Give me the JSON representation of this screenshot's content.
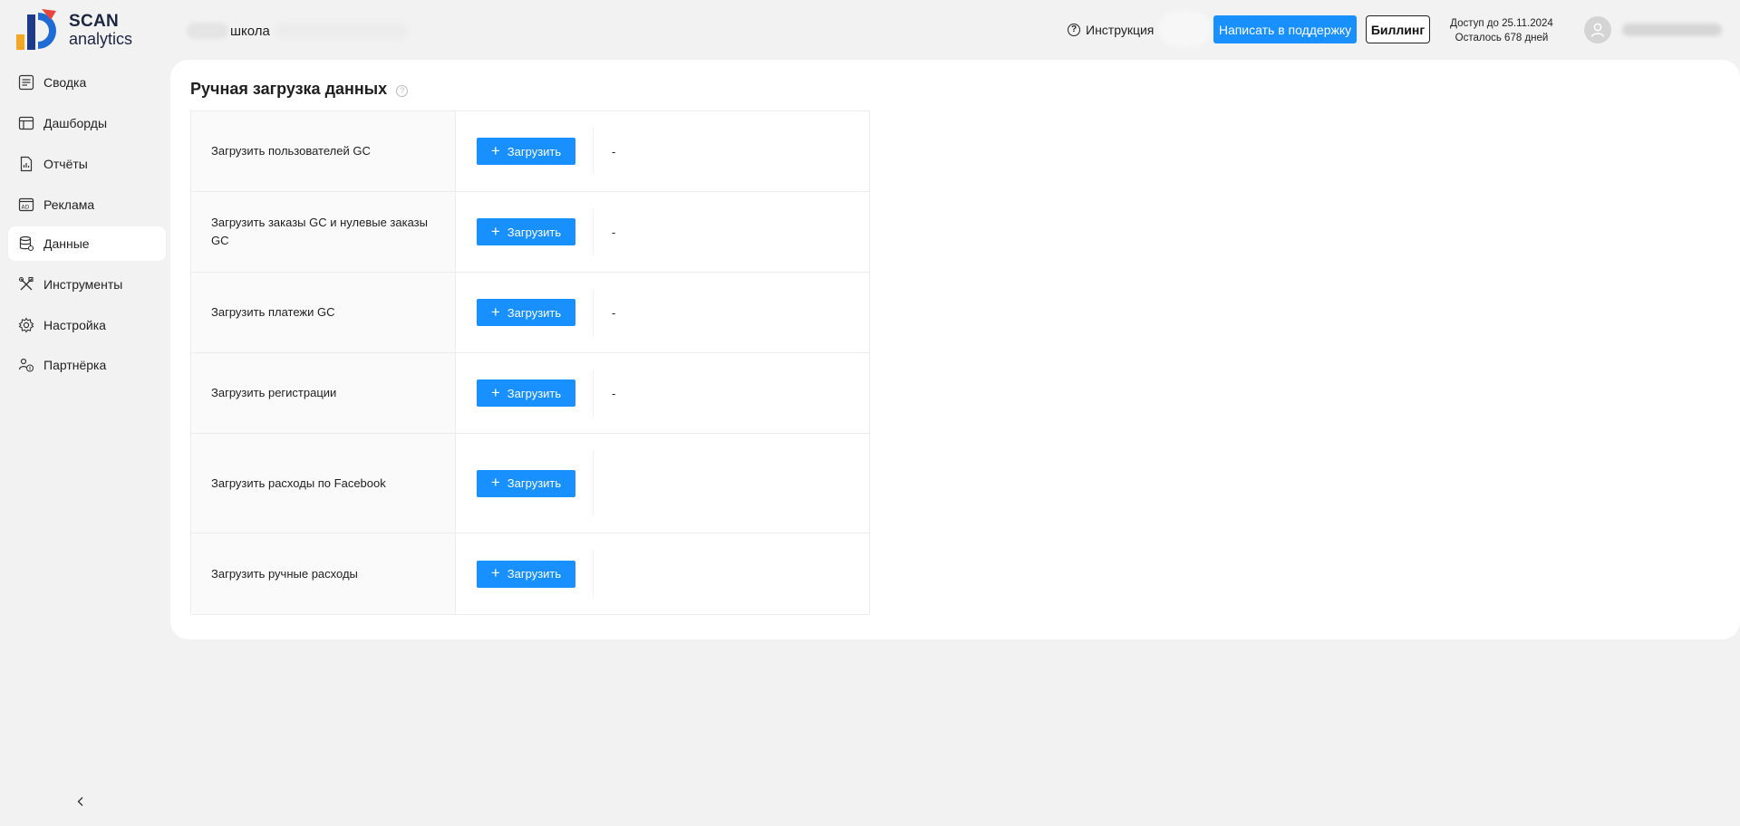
{
  "brand": {
    "line1": "SCAN",
    "line2": "analytics"
  },
  "header": {
    "project_name": "школа",
    "help_label": "Инструкция",
    "support_label": "Написать в поддержку",
    "billing_label": "Биллинг",
    "access_until": "Доступ до 25.11.2024",
    "days_left": "Осталось 678 дней"
  },
  "sidebar": {
    "items": [
      {
        "label": "Сводка",
        "icon": "summary-icon"
      },
      {
        "label": "Дашборды",
        "icon": "dashboard-icon"
      },
      {
        "label": "Отчёты",
        "icon": "report-icon"
      },
      {
        "label": "Реклама",
        "icon": "ads-icon"
      },
      {
        "label": "Данные",
        "icon": "database-icon",
        "active": true
      },
      {
        "label": "Инструменты",
        "icon": "tools-icon"
      },
      {
        "label": "Настройка",
        "icon": "settings-icon"
      },
      {
        "label": "Партнёрка",
        "icon": "partner-icon"
      }
    ]
  },
  "page": {
    "title": "Ручная загрузка данных",
    "upload_label": "Загрузить",
    "rows": [
      {
        "label": "Загрузить пользователей GC",
        "status": "-"
      },
      {
        "label": "Загрузить заказы GC и нулевые заказы GC",
        "status": "-"
      },
      {
        "label": "Загрузить платежи GC",
        "status": "-"
      },
      {
        "label": "Загрузить регистрации",
        "status": "-"
      },
      {
        "label": "Загрузить расходы по Facebook",
        "status": ""
      },
      {
        "label": "Загрузить ручные расходы",
        "status": ""
      }
    ]
  },
  "colors": {
    "accent": "#1890ff",
    "background": "#f2f2f2",
    "card": "#ffffff",
    "logo_orange": "#f5a623",
    "logo_blue": "#1e6bd6",
    "logo_red": "#e8453c"
  }
}
